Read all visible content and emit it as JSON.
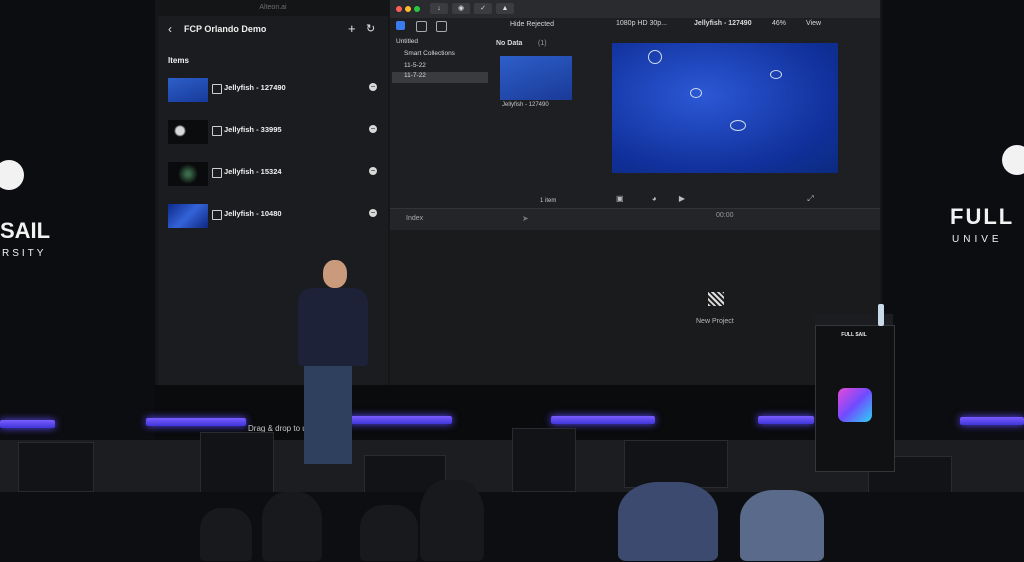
{
  "left_panel": {
    "url_text": "Alteon.ai",
    "title": "FCP Orlando Demo",
    "back_icon": "chevron-left-icon",
    "plus_icon": "plus-icon",
    "refresh_icon": "refresh-icon",
    "items_heading": "Items",
    "items": [
      {
        "label": "Jellyfish - 127490"
      },
      {
        "label": "Jellyfish - 33995"
      },
      {
        "label": "Jellyfish - 15324"
      },
      {
        "label": "Jellyfish - 10480"
      }
    ],
    "drag_hint": "Drag & drop to up"
  },
  "fcp": {
    "filter": "Hide Rejected",
    "format": "1080p HD 30p...",
    "clip_name": "Jellyfish - 127490",
    "zoom": "46%",
    "view": "View",
    "sidebar": [
      "Untitled",
      "Smart Collections",
      "11-5-22",
      "11-7-22"
    ],
    "browser_heading": "No Data",
    "browser_count": "(1)",
    "thumb_label": "Jellyfish - 127490",
    "item_count": "1 item",
    "index": "Index",
    "timecode": "00:00",
    "new_project": "New Project"
  },
  "stage": {
    "logo_left_line1": "SAIL",
    "logo_left_line2": "RSITY",
    "logo_right_line1": "FULL",
    "logo_right_line2": "UNIVE",
    "podium_logo": "FULL SAIL"
  },
  "colors": {
    "led_purple": "#5b49ff",
    "viewer_blue": "#2c58d6"
  }
}
